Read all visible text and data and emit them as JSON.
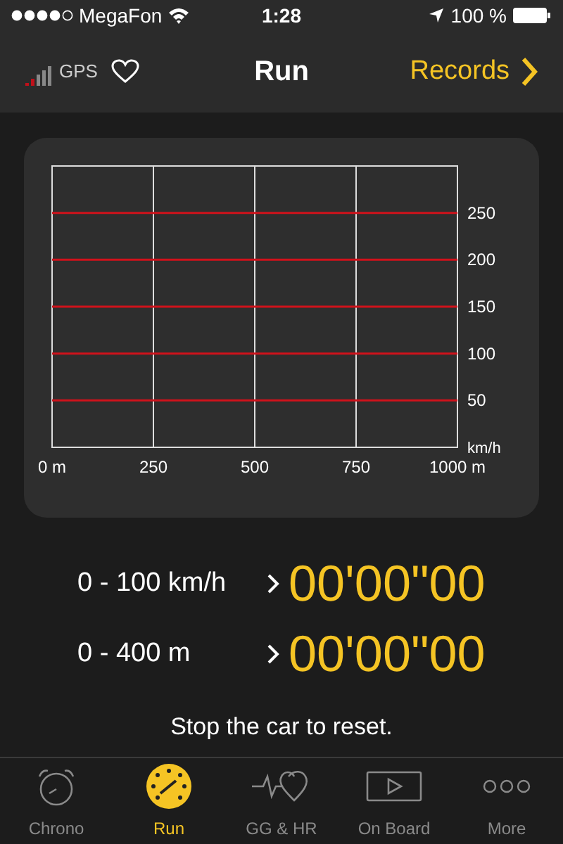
{
  "status_bar": {
    "carrier": "MegaFon",
    "time": "1:28",
    "battery": "100 %"
  },
  "nav": {
    "gps_label": "GPS",
    "title": "Run",
    "records": "Records"
  },
  "chart": {
    "chart_data": {
      "type": "line",
      "grid": true,
      "ylabel": "km/h",
      "xlim": [
        0,
        1000
      ],
      "ylim": [
        0,
        300
      ],
      "xticks": [
        {
          "value": 0,
          "label": "0 m"
        },
        250,
        500,
        750,
        {
          "value": 1000,
          "label": "1000 m"
        }
      ],
      "yticks": [
        50,
        100,
        150,
        200,
        250
      ]
    }
  },
  "results": [
    {
      "label": "0 - 100 km/h",
      "time": "00'00\"00"
    },
    {
      "label": "0 - 400 m",
      "time": "00'00\"00"
    }
  ],
  "hint": "Stop the car to reset.",
  "tabs": [
    {
      "label": "Chrono",
      "kind": "chrono",
      "selected": false
    },
    {
      "label": "Run",
      "kind": "run",
      "selected": true
    },
    {
      "label": "GG & HR",
      "kind": "heart",
      "selected": false
    },
    {
      "label": "On Board",
      "kind": "video",
      "selected": false
    },
    {
      "label": "More",
      "kind": "more",
      "selected": false
    }
  ]
}
